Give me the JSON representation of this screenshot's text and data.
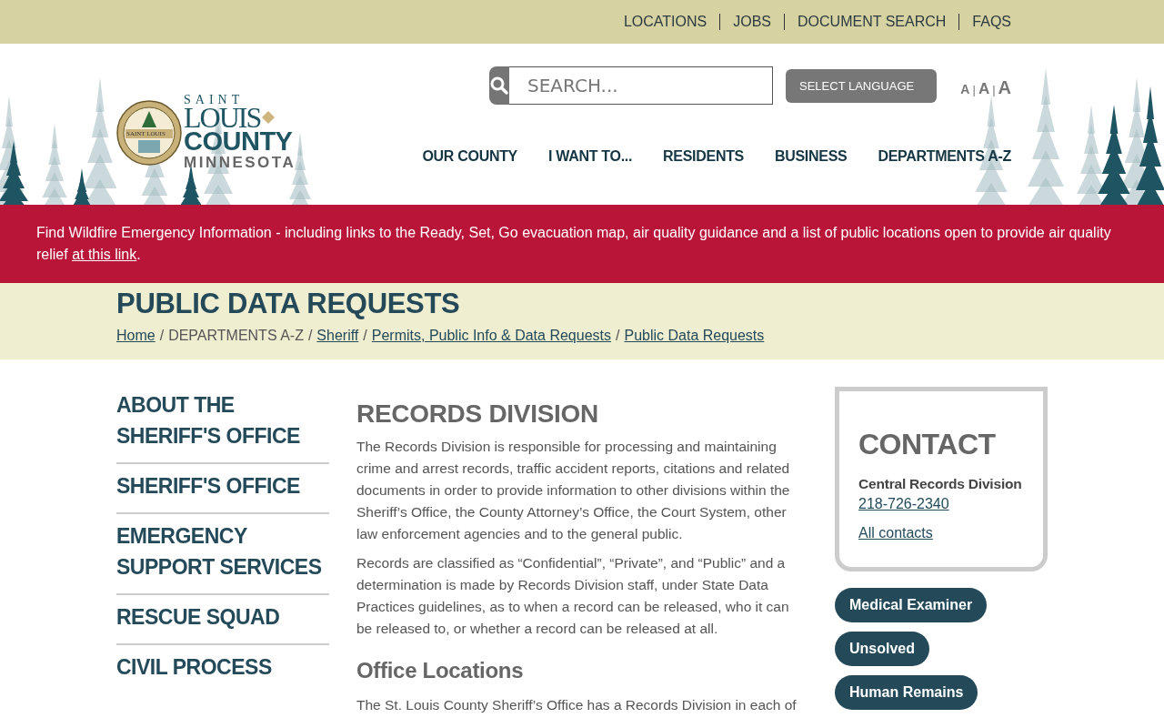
{
  "top_links": [
    "LOCATIONS",
    "JOBS",
    "DOCUMENT SEARCH",
    "FAQS"
  ],
  "header": {
    "logo": {
      "line_1": "SAINT",
      "line_2": "LOUIS",
      "line_3": "COUNTY",
      "line_4": "MINNESOTA",
      "seal_text": "SAINT LOUIS"
    },
    "search": {
      "placeholder": "SEARCH..."
    },
    "language_button": "SELECT LANGUAGE",
    "text_size": {
      "sizes": [
        "A",
        "A",
        "A"
      ],
      "separator": "|"
    },
    "nav": [
      "OUR COUNTY",
      "I WANT TO...",
      "RESIDENTS",
      "BUSINESS",
      "DEPARTMENTS A-Z"
    ]
  },
  "alert": {
    "text": "Find Wildfire Emergency Information - including links to the Ready, Set, Go evacuation map, air quality guidance and a list of public locations open to provide air quality relief ",
    "link": "at this link",
    "after": "."
  },
  "page_title": "PUBLIC DATA REQUESTS",
  "breadcrumbs": [
    {
      "label": "Home",
      "link": true
    },
    {
      "label": "DEPARTMENTS A-Z",
      "link": false
    },
    {
      "label": "Sheriff",
      "link": true
    },
    {
      "label": "Permits, Public Info & Data Requests",
      "link": true
    },
    {
      "label": "Public Data Requests",
      "link": true
    }
  ],
  "breadcrumb_separator": "/",
  "sidebar": [
    "ABOUT THE SHERIFF'S OFFICE",
    "SHERIFF'S OFFICE",
    "EMERGENCY SUPPORT SERVICES",
    "RESCUE SQUAD",
    "CIVIL PROCESS"
  ],
  "main": {
    "heading": "RECORDS DIVISION",
    "paragraphs": [
      "The Records Division is responsible for processing and maintaining crime and arrest records, traffic accident reports, citations and related documents in order to provide information to other divisions within the Sheriff’s Office, the County Attorney’s Office, the Court System, other law enforcement agencies and to the general public.",
      "Records are classified as “Confidential”, “Private”, and “Public” and a determination is made by Records Division staff, under State Data Practices guidelines, as to when a record can be released, who it can be released to, or whether a record can be released at all."
    ],
    "subheading": "Office Locations",
    "paragraph_2": "The St. Louis County Sheriff’s Office has a Records Division in each of"
  },
  "contact": {
    "title": "CONTACT",
    "name": "Central Records Division",
    "phone": "218-726-2340",
    "link": "All contacts"
  },
  "tags": [
    "Medical Examiner",
    "Unsolved",
    "Human Remains"
  ]
}
